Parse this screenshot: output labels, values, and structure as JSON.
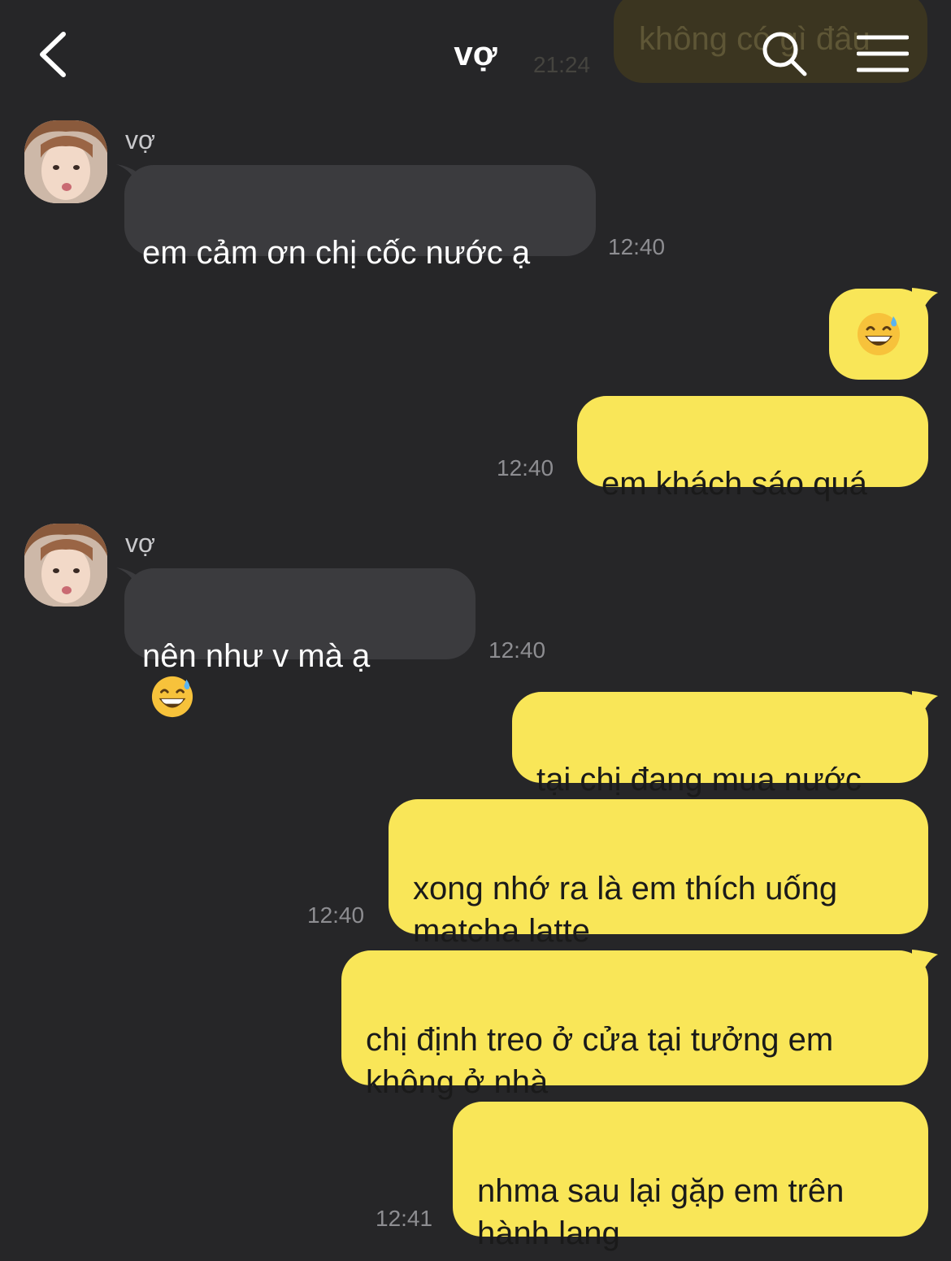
{
  "header": {
    "title": "vợ",
    "scrolled_preview_text": "không có gì đâu",
    "scrolled_preview_time": "21:24"
  },
  "messages": [
    {
      "sender": "vợ",
      "side": "in",
      "text": "em cảm ơn chị cốc nước ạ",
      "time": "12:40"
    },
    {
      "side": "out",
      "emoji": "grinning-face-with-sweat",
      "time": ""
    },
    {
      "side": "out",
      "text": "em khách sáo quá",
      "time": "12:40"
    },
    {
      "sender": "vợ",
      "side": "in",
      "text": "nên như v mà ạ",
      "emoji": "grinning-face-with-sweat",
      "time": "12:40"
    },
    {
      "side": "out",
      "text": "tại chị đang mua nước",
      "time": ""
    },
    {
      "side": "out",
      "text": "xong nhớ ra là em thích uống\nmatcha latte",
      "time": "12:40"
    },
    {
      "side": "out",
      "text": "chị định treo ở cửa tại tưởng em\nkhông ở nhà",
      "time": ""
    },
    {
      "side": "out",
      "text": "nhma sau lại gặp em trên\nhành lang",
      "time": "12:41"
    }
  ],
  "colors": {
    "background": "#262628",
    "incoming_bubble": "#3b3b3e",
    "outgoing_bubble": "#f9e658",
    "timestamp": "#8d8d91"
  }
}
